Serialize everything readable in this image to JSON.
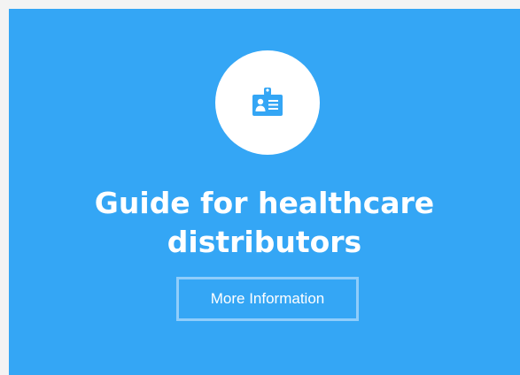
{
  "card": {
    "icon": "id-badge-icon",
    "title": "Guide for healthcare distributors",
    "button_label": "More Information",
    "background_color": "#34a6f5",
    "icon_color": "#34a6f5"
  }
}
